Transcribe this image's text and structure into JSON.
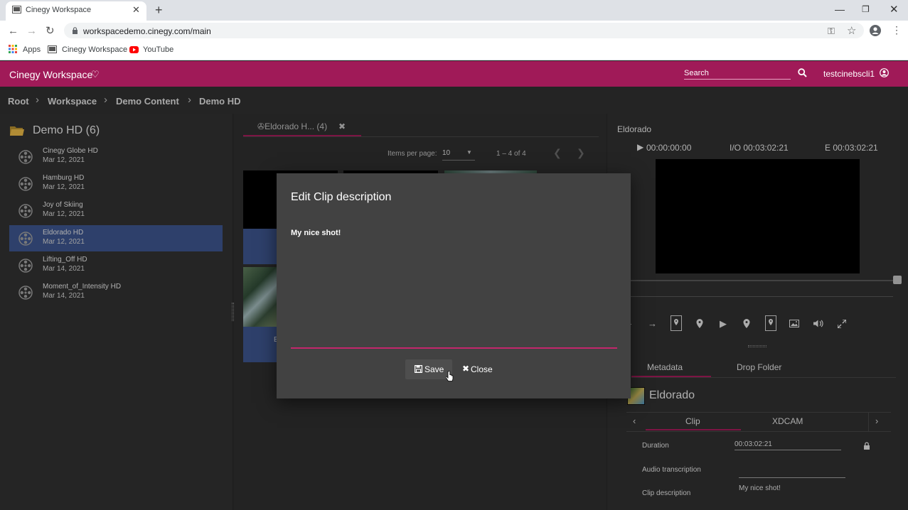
{
  "browser": {
    "tab_title": "Cinegy Workspace",
    "url": "workspacedemo.cinegy.com/main",
    "bookmarks": [
      "Apps",
      "Cinegy Workspace",
      "YouTube"
    ]
  },
  "app": {
    "title": "Cinegy Workspace",
    "search_placeholder": "Search",
    "username": "testcinebscli1"
  },
  "breadcrumb": [
    "Root",
    "Workspace",
    "Demo Content",
    "Demo HD"
  ],
  "folder": {
    "title": "Demo HD (6)",
    "items": [
      {
        "name": "Cinegy Globe HD",
        "date": "Mar 12, 2021"
      },
      {
        "name": "Hamburg HD",
        "date": "Mar 12, 2021"
      },
      {
        "name": "Joy of Skiing",
        "date": "Mar 12, 2021"
      },
      {
        "name": "Eldorado HD",
        "date": "Mar 12, 2021"
      },
      {
        "name": "Lifting_Off HD",
        "date": "Mar 14, 2021"
      },
      {
        "name": "Moment_of_Intensity HD",
        "date": "Mar 14, 2021"
      }
    ],
    "selected_index": 3
  },
  "middle": {
    "tab_label": "Eldorado H... (4)",
    "items_per_page_label": "Items per page:",
    "items_per_page_value": "10",
    "range": "1 – 4 of 4",
    "thumb_caption_letter": "E"
  },
  "player": {
    "clip_name": "Eldorado",
    "position": "00:00:00:00",
    "io": "I/O 00:03:02:21",
    "end": "E 00:03:02:21"
  },
  "metadata": {
    "tabs": [
      "Metadata",
      "Drop Folder"
    ],
    "clip_title": "Eldorado",
    "subtabs": [
      "Clip",
      "XDCAM"
    ],
    "fields": {
      "duration_label": "Duration",
      "duration_value": "00:03:02:21",
      "audio_label": "Audio transcription",
      "audio_value": "",
      "description_label": "Clip description",
      "description_value": "My nice shot!"
    }
  },
  "modal": {
    "title": "Edit Clip description",
    "text": "My nice shot!",
    "save_label": "Save",
    "close_label": "Close"
  },
  "colors": {
    "brand": "#a01a58",
    "selection": "#3c5389",
    "accent_line": "#c3276c"
  }
}
